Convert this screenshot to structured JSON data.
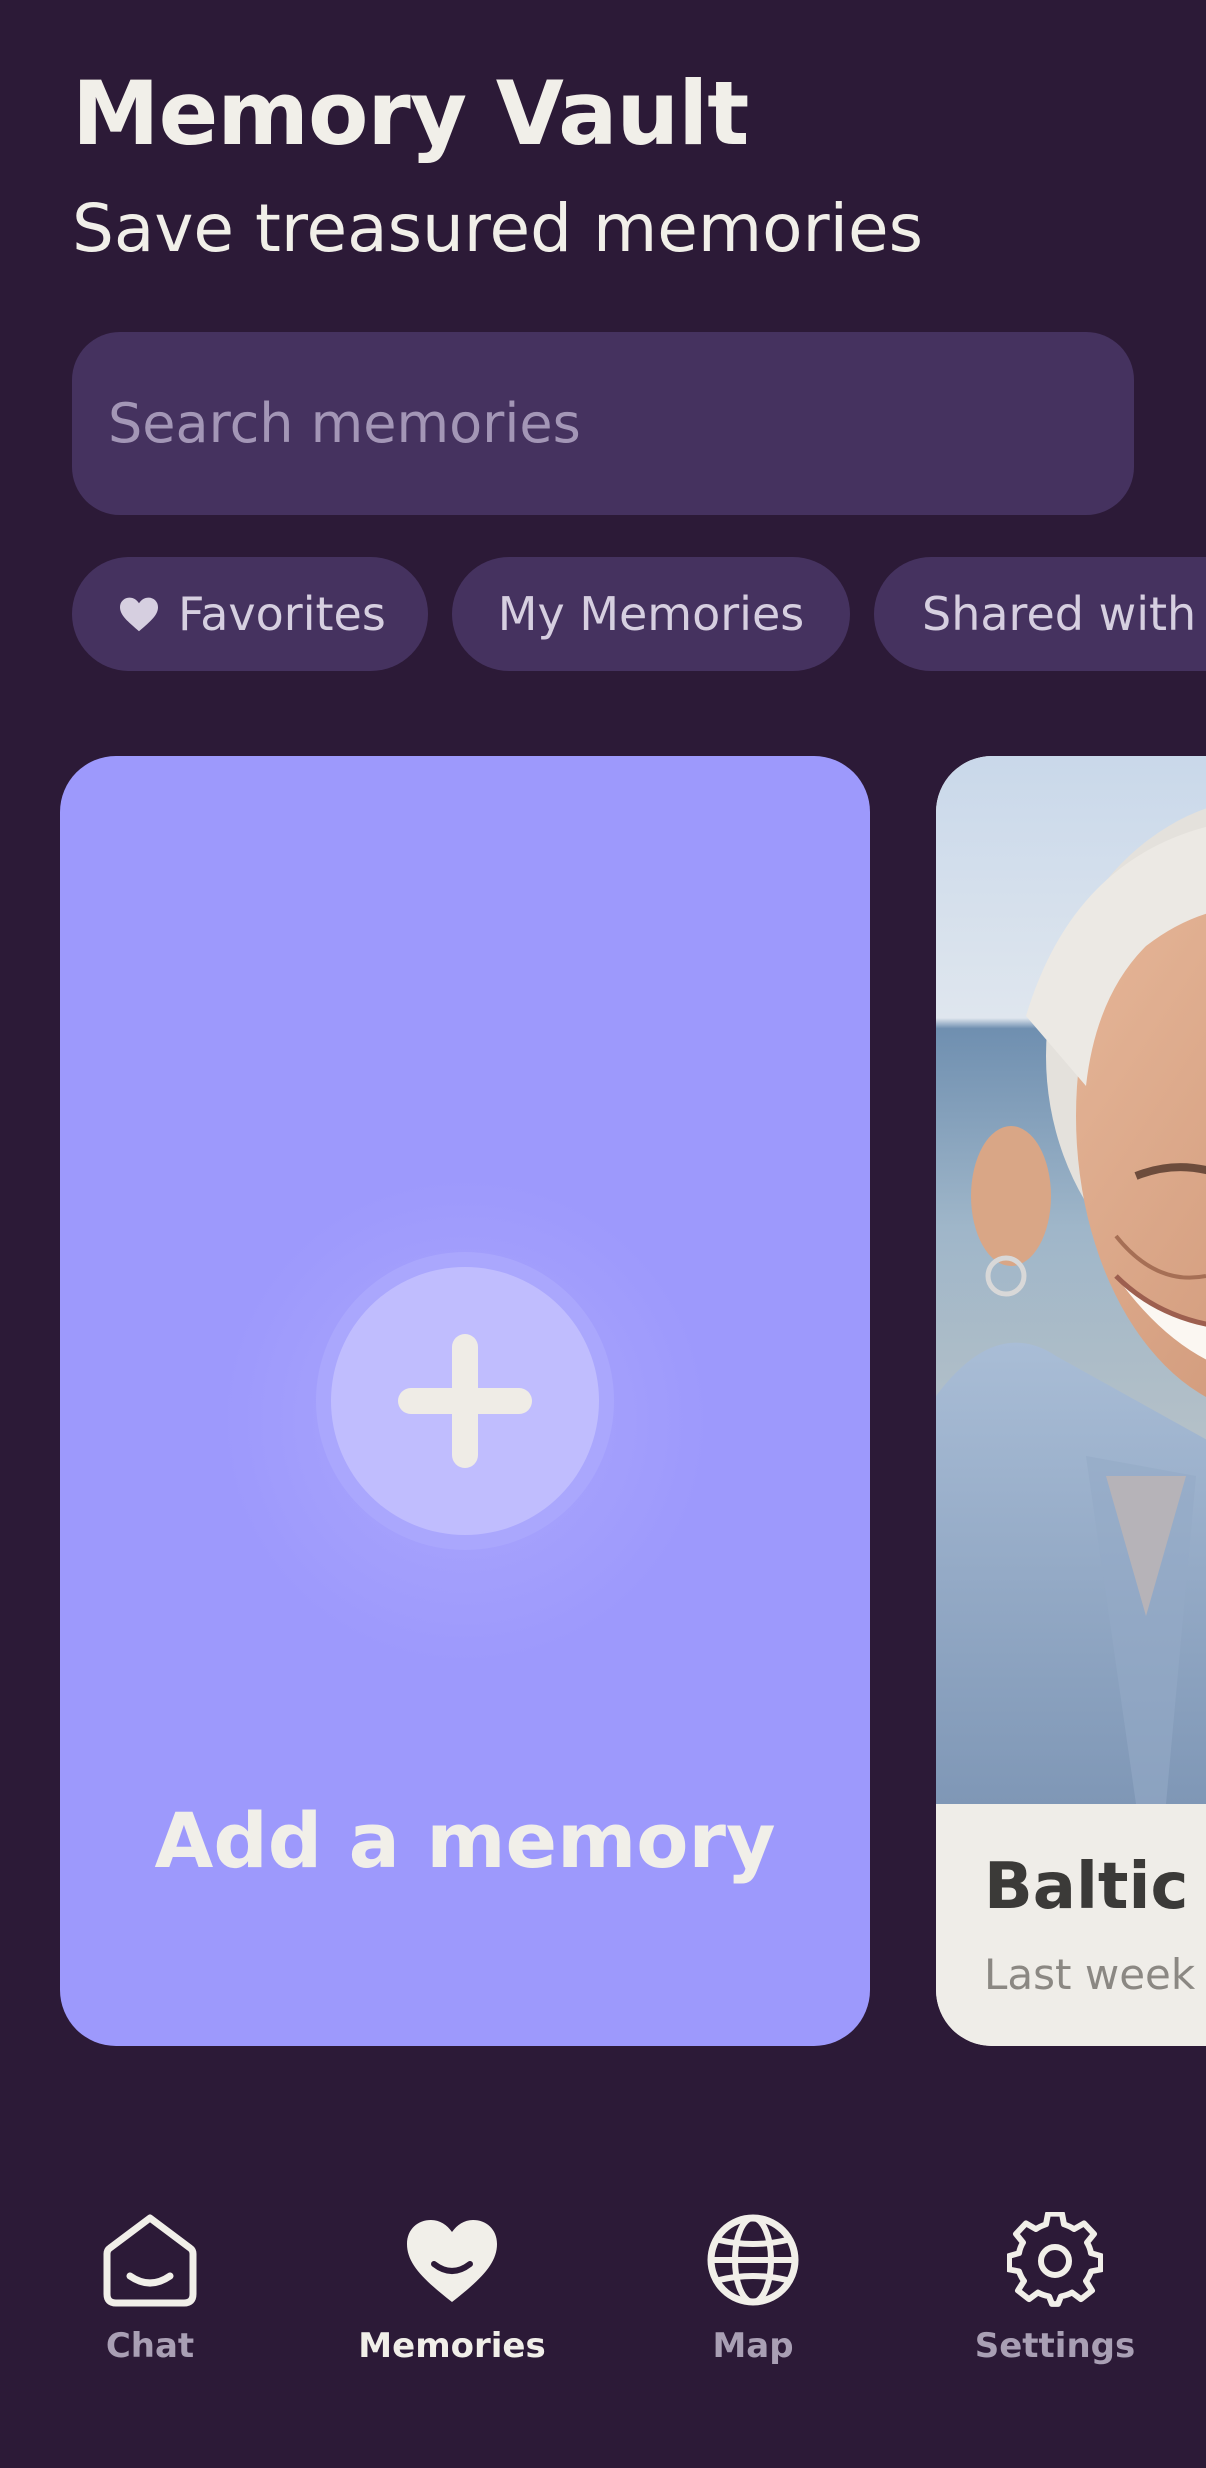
{
  "header": {
    "title": "Memory Vault",
    "subtitle": "Save treasured memories"
  },
  "search": {
    "placeholder": "Search memories",
    "value": ""
  },
  "filters": [
    {
      "label": "Favorites",
      "icon": "heart-icon"
    },
    {
      "label": "My Memories"
    },
    {
      "label": "Shared with"
    }
  ],
  "add_card": {
    "label": "Add a memory",
    "icon": "plus-icon",
    "color": "#9d99fc"
  },
  "memories": [
    {
      "title": "Baltic S",
      "date": "Last week"
    }
  ],
  "nav": {
    "items": [
      {
        "label": "Chat",
        "icon": "chat-icon",
        "active": false
      },
      {
        "label": "Memories",
        "icon": "heart-icon",
        "active": true
      },
      {
        "label": "Map",
        "icon": "globe-icon",
        "active": false
      },
      {
        "label": "Settings",
        "icon": "gear-icon",
        "active": false
      }
    ]
  },
  "colors": {
    "background": "#2c1a37",
    "chip": "#45325f",
    "text_light": "#f1efe9",
    "nav_inactive": "#a99fb4"
  }
}
